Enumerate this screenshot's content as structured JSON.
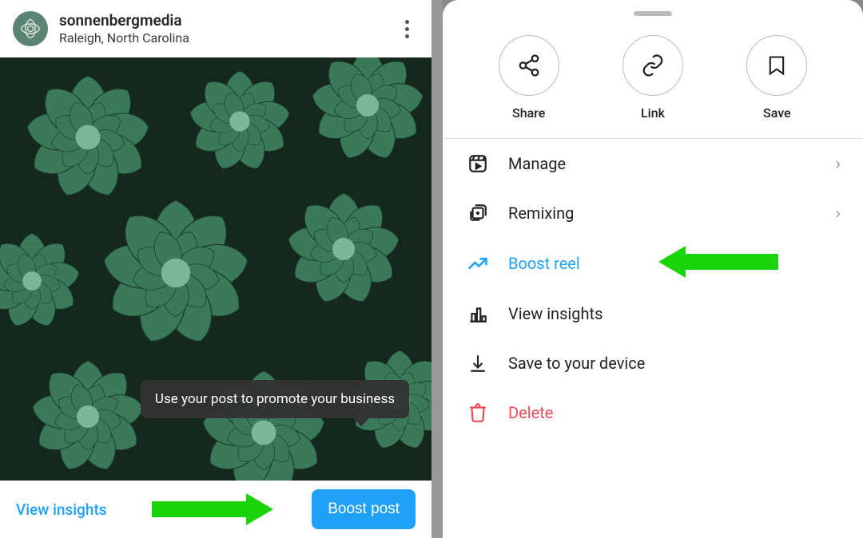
{
  "left": {
    "username": "sonnenbergmedia",
    "location": "Raleigh, North Carolina",
    "tooltip": "Use your post to promote your business",
    "view_insights": "View insights",
    "boost_post": "Boost post"
  },
  "sheet": {
    "actions": {
      "share": "Share",
      "link": "Link",
      "save": "Save"
    },
    "items": {
      "manage": "Manage",
      "remixing": "Remixing",
      "boost_reel": "Boost reel",
      "view_insights": "View insights",
      "save_device": "Save to your device",
      "delete": "Delete"
    }
  },
  "colors": {
    "accent": "#1ea1f7",
    "arrow": "#1bd40b",
    "danger": "#ed4956"
  }
}
